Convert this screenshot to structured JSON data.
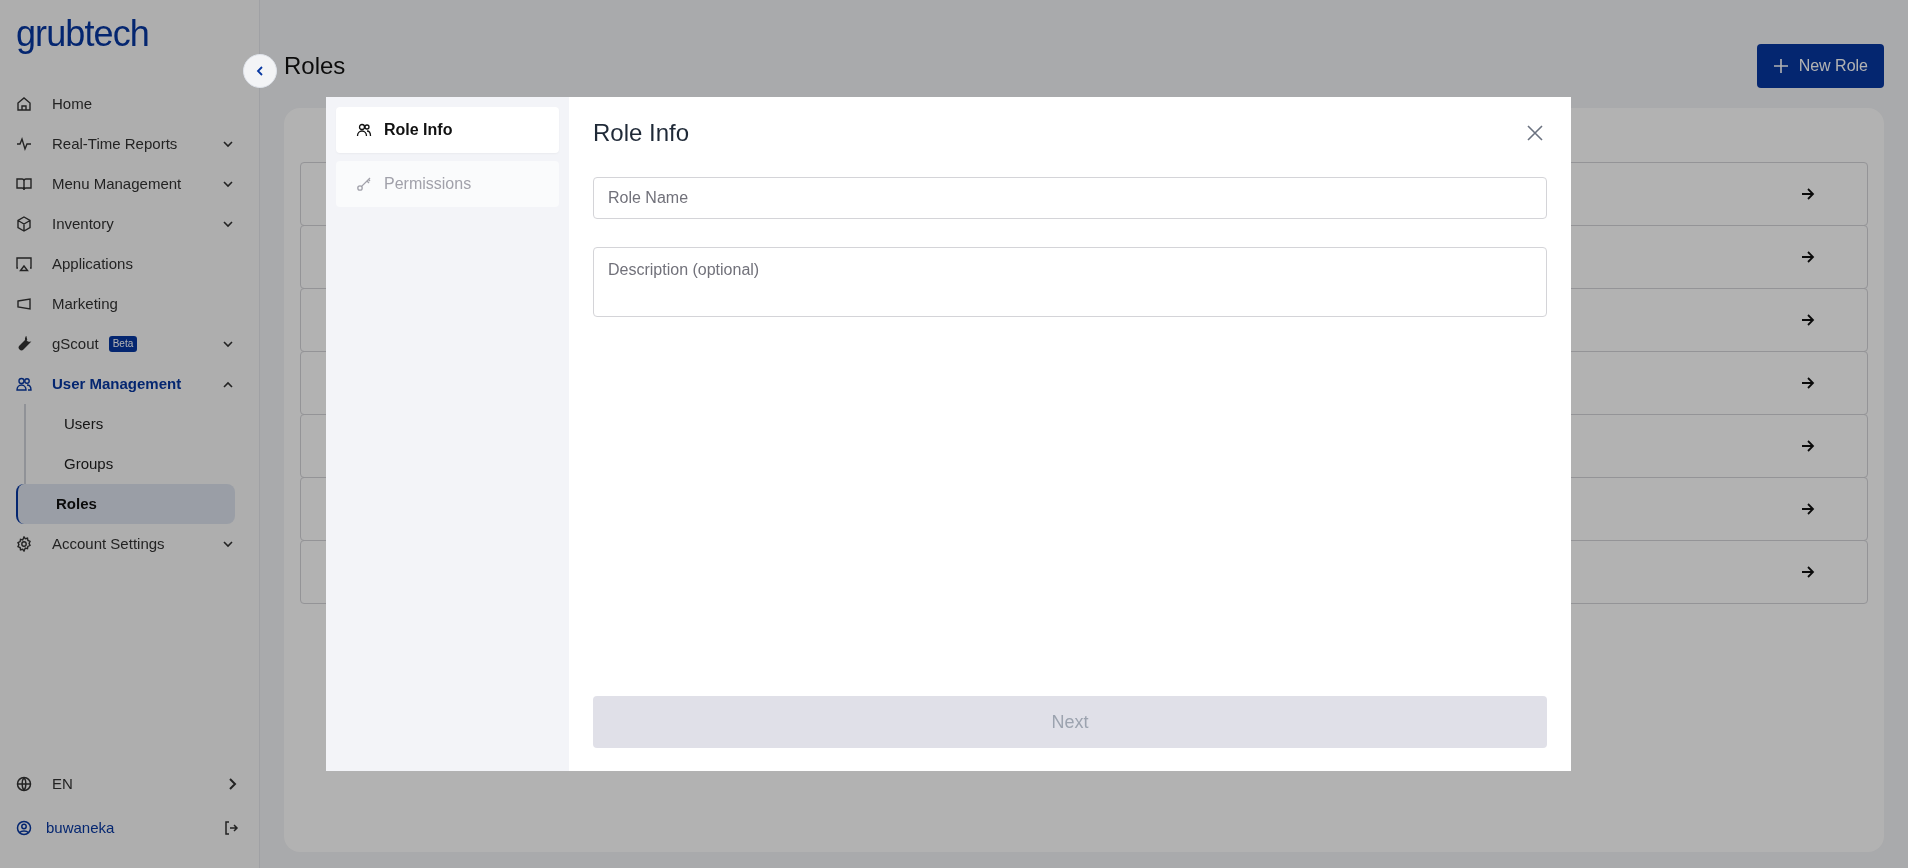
{
  "sidebar": {
    "logo": "grubtech",
    "items": [
      {
        "label": "Home",
        "expandable": false
      },
      {
        "label": "Real-Time Reports",
        "expandable": true,
        "expanded": false
      },
      {
        "label": "Menu Management",
        "expandable": true,
        "expanded": false
      },
      {
        "label": "Inventory",
        "expandable": true,
        "expanded": false
      },
      {
        "label": "Applications",
        "expandable": false
      },
      {
        "label": "Marketing",
        "expandable": false
      },
      {
        "label": "gScout",
        "badge": "Beta",
        "expandable": true,
        "expanded": false
      },
      {
        "label": "User Management",
        "expandable": true,
        "expanded": true,
        "active": true,
        "children": [
          {
            "label": "Users",
            "selected": false
          },
          {
            "label": "Groups",
            "selected": false
          },
          {
            "label": "Roles",
            "selected": true
          }
        ]
      },
      {
        "label": "Account Settings",
        "expandable": true,
        "expanded": false
      }
    ],
    "language": "EN",
    "user": "buwaneka"
  },
  "page": {
    "title": "Roles",
    "new_button": "New Role"
  },
  "modal": {
    "steps": [
      {
        "label": "Role Info",
        "selected": true,
        "disabled": false
      },
      {
        "label": "Permissions",
        "selected": false,
        "disabled": true
      }
    ],
    "title": "Role Info",
    "fields": [
      {
        "kind": "input",
        "placeholder": "Role Name"
      },
      {
        "kind": "textarea",
        "placeholder": "Description (optional)"
      }
    ],
    "next_button": {
      "label": "Next",
      "disabled": true
    }
  }
}
